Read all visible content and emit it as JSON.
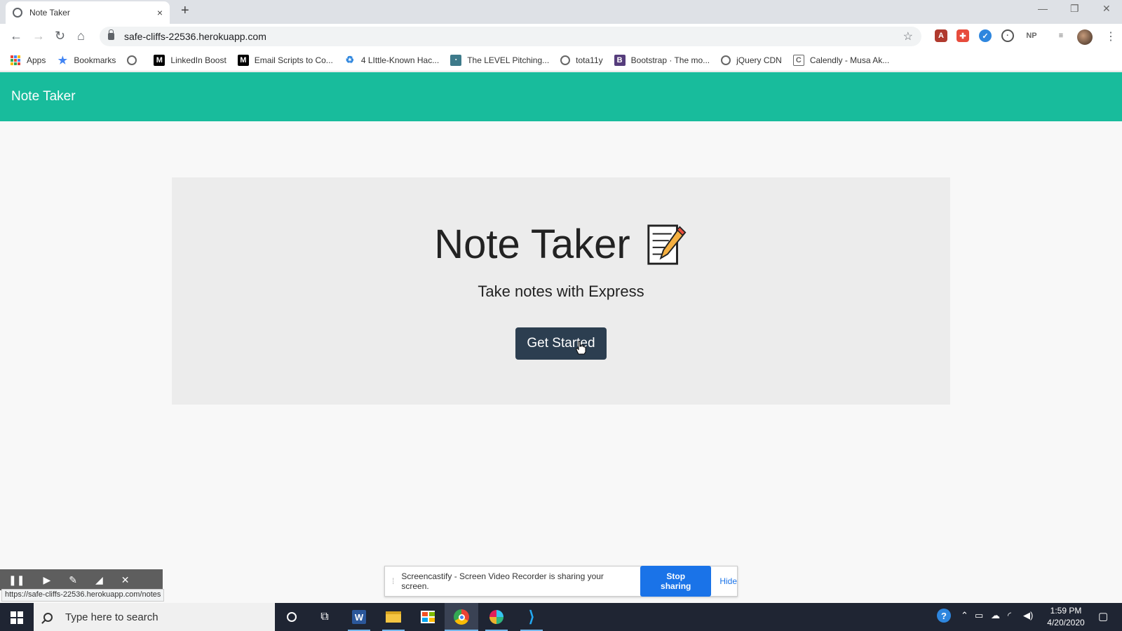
{
  "browser": {
    "tab_title": "Note Taker",
    "tab_close": "×",
    "new_tab": "+",
    "url": "safe-cliffs-22536.herokuapp.com",
    "bookmarks": [
      {
        "label": "Apps",
        "icon": "apps-grid-icon"
      },
      {
        "label": "Bookmarks",
        "icon": "star-icon"
      },
      {
        "label": "",
        "icon": "globe-icon"
      },
      {
        "label": "LinkedIn Boost",
        "icon": "medium-icon"
      },
      {
        "label": "Email Scripts to Co...",
        "icon": "medium-icon"
      },
      {
        "label": "4 LIttle-Known Hac...",
        "icon": "recycle-icon"
      },
      {
        "label": "The LEVEL Pitching...",
        "icon": "image-icon"
      },
      {
        "label": "tota11y",
        "icon": "globe-icon"
      },
      {
        "label": "Bootstrap · The mo...",
        "icon": "bootstrap-icon"
      },
      {
        "label": "jQuery CDN",
        "icon": "globe-icon"
      },
      {
        "label": "Calendly - Musa Ak...",
        "icon": "calendly-icon"
      }
    ],
    "extensions": [
      "NP"
    ]
  },
  "app": {
    "brand": "Note Taker",
    "hero_title": "Note Taker",
    "hero_subtitle": "Take notes with Express",
    "cta_label": "Get Started"
  },
  "status_url": "https://safe-cliffs-22536.herokuapp.com/notes",
  "share_bar": {
    "message": "Screencastify - Screen Video Recorder is sharing your screen.",
    "stop_label": "Stop sharing",
    "hide_label": "Hide"
  },
  "taskbar": {
    "search_placeholder": "Type here to search",
    "time": "1:59 PM",
    "date": "4/20/2020"
  },
  "colors": {
    "navbar": "#18bc9c",
    "button": "#2c3e50",
    "share_button": "#1a73e8"
  }
}
